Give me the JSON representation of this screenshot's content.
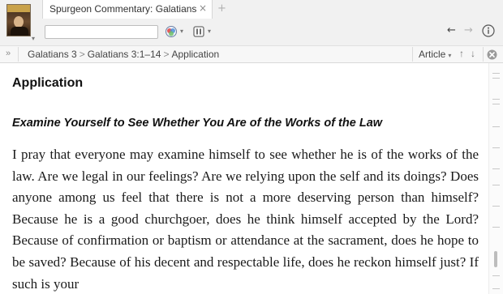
{
  "window": {
    "tab_title": "Spurgeon Commentary: Galatians",
    "tab_close_glyph": "×",
    "tab_add_glyph": "+"
  },
  "toolbar": {
    "search_value": "",
    "search_placeholder": "",
    "back_glyph": "←",
    "forward_glyph": "→"
  },
  "breadcrumb": {
    "expand_glyph": "»",
    "items": [
      "Galatians 3",
      "Galatians 3:1–14",
      "Application"
    ],
    "separator": ">",
    "article_label": "Article",
    "up_glyph": "↑",
    "down_glyph": "↓"
  },
  "content": {
    "section_heading": "Application",
    "subheading": "Examine Yourself to See Whether You Are of the Works of the Law",
    "paragraph": "I pray that everyone may examine himself to see whether he is of the works of the law. Are we legal in our feelings? Are we relying upon the self and its doings? Does anyone among us feel that there is not a more deserving person than himself? Because he is a good churchgoer, does he think himself accepted by the Lord? Because of confirmation or baptism or attendance at the sacrament, does he hope to be saved? Because of his decent and respectable life, does he reckon himself just? If such is your"
  },
  "icons": {
    "thumbnail": "spurgeon-portrait-icon",
    "visual_filter": "visual-filter-icon",
    "panel_menu": "panel-menu-icon",
    "info": "info-icon",
    "close_panel": "close-circle-icon"
  },
  "colors": {
    "chrome_bg": "#f1f1f1",
    "crumb_bg": "#f7f7f7",
    "text": "#1a1a1a"
  }
}
